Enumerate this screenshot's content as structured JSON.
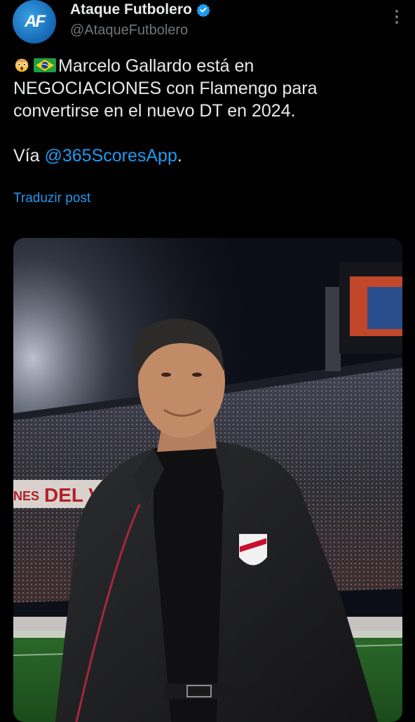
{
  "author": {
    "display_name": "Ataque Futbolero",
    "handle": "@AtaqueFutbolero",
    "avatar_text": "AF",
    "verified": true
  },
  "tweet": {
    "line1": "Marcelo Gallardo está en",
    "line2": "NEGOCIACIONES con Flamengo para",
    "line3": "convertirse en el nuevo DT en 2024.",
    "via_prefix": "Vía ",
    "mention": "@365ScoresApp",
    "via_suffix": ".",
    "emojis": [
      "astonished-face-emoji",
      "brazil-flag-emoji"
    ]
  },
  "translate_label": "Traduzir post",
  "photo": {
    "banner_text": "DEL VI",
    "banner_text_left": "NES"
  },
  "colors": {
    "background": "#000000",
    "link": "#1d9bf0",
    "secondary_text": "#71767b",
    "primary_text": "#e7e9ea"
  }
}
